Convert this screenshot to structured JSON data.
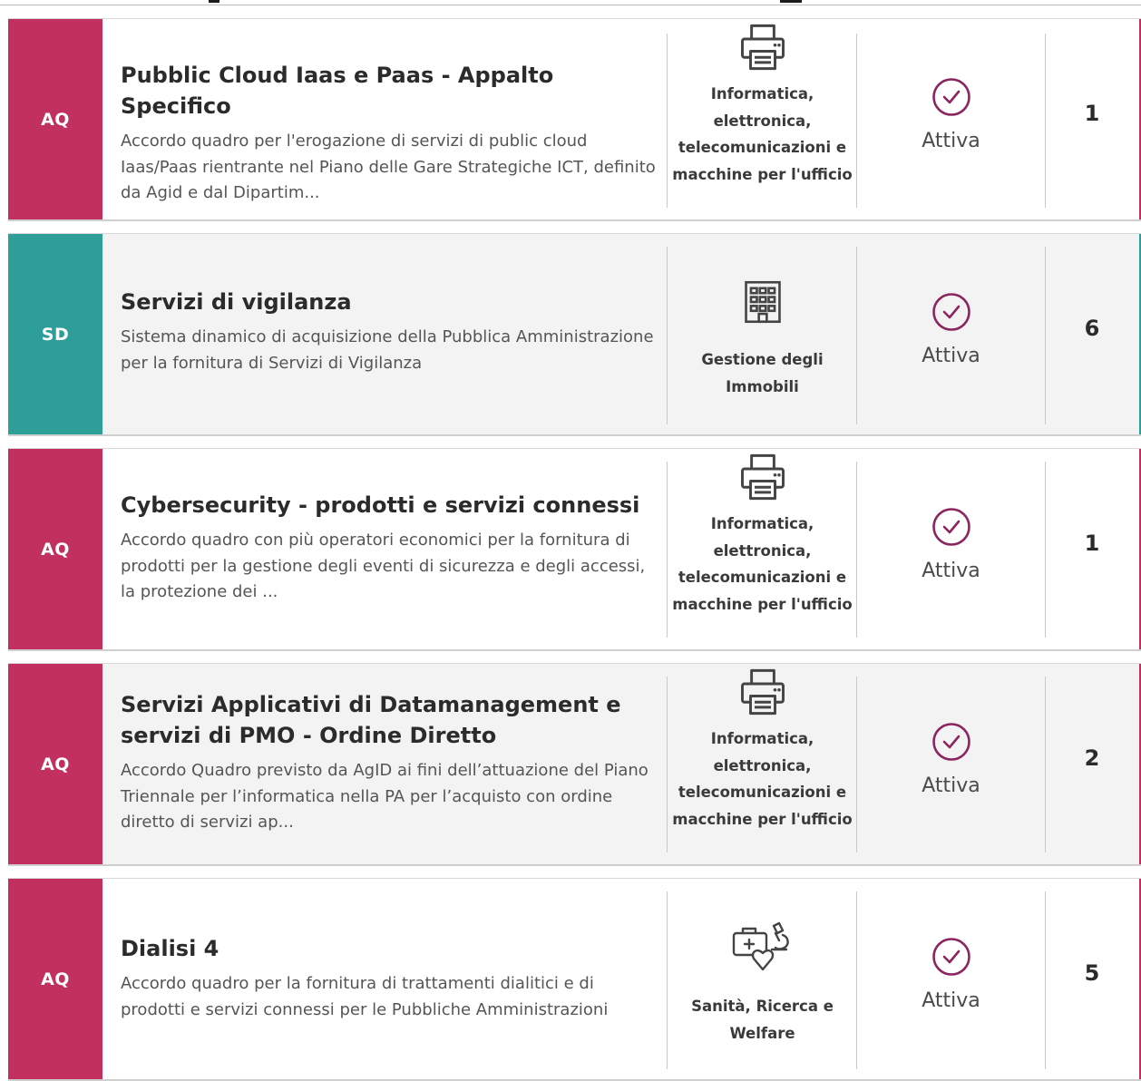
{
  "colors": {
    "aq": "#c2305f",
    "sd": "#2e9e99",
    "status_icon": "#8b2560"
  },
  "items": [
    {
      "badge": "AQ",
      "title": "Pubblic Cloud Iaas e Paas - Appalto Specifico",
      "description": "Accordo quadro per l'erogazione di servizi di public cloud Iaas/Paas rientrante nel Piano delle Gare Strategiche ICT, definito da Agid e dal Dipartim...",
      "category": "Informatica, elettronica, telecomunicazioni e macchine per l'ufficio",
      "category_icon": "printer-icon",
      "status": "Attiva",
      "status_icon": "check-circle-icon",
      "count": "1"
    },
    {
      "badge": "SD",
      "title": "Servizi di vigilanza",
      "description": "Sistema dinamico di acquisizione della Pubblica Amministrazione per la fornitura di Servizi di Vigilanza",
      "category": "Gestione degli Immobili",
      "category_icon": "building-icon",
      "status": "Attiva",
      "status_icon": "check-circle-icon",
      "count": "6"
    },
    {
      "badge": "AQ",
      "title": "Cybersecurity - prodotti e servizi connessi",
      "description": "Accordo quadro con più operatori economici per la fornitura di prodotti per la gestione degli eventi di sicurezza e degli accessi, la protezione dei ...",
      "category": "Informatica, elettronica, telecomunicazioni e macchine per l'ufficio",
      "category_icon": "printer-icon",
      "status": "Attiva",
      "status_icon": "check-circle-icon",
      "count": "1"
    },
    {
      "badge": "AQ",
      "title": "Servizi Applicativi di Datamanagement e servizi di PMO - Ordine Diretto",
      "description": "Accordo Quadro previsto da AgID ai fini dell’attuazione del Piano Triennale per l’informatica nella PA per l’acquisto con ordine diretto di servizi ap...",
      "category": "Informatica, elettronica, telecomunicazioni e macchine per l'ufficio",
      "category_icon": "printer-icon",
      "status": "Attiva",
      "status_icon": "check-circle-icon",
      "count": "2"
    },
    {
      "badge": "AQ",
      "title": "Dialisi 4",
      "description": "Accordo quadro per la fornitura di trattamenti dialitici e di prodotti e servizi connessi per le Pubbliche Amministrazioni",
      "category": "Sanità, Ricerca e Welfare",
      "category_icon": "healthcare-icon",
      "status": "Attiva",
      "status_icon": "check-circle-icon",
      "count": "5"
    }
  ]
}
